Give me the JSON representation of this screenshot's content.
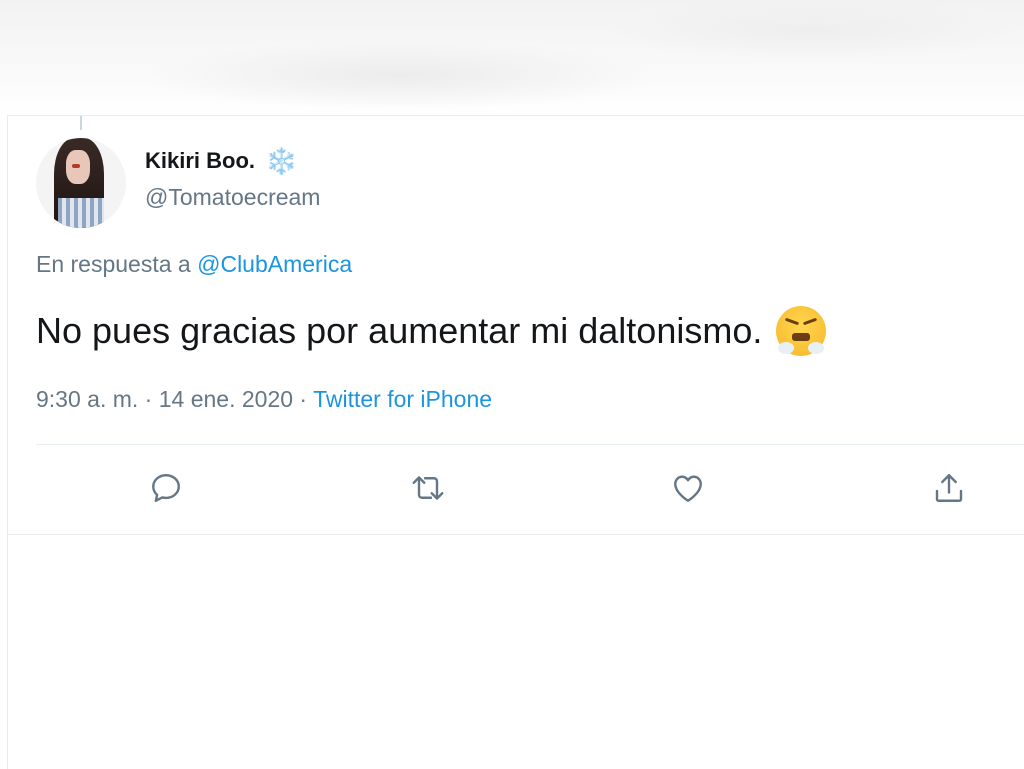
{
  "tweet": {
    "display_name": "Kikiri Boo.",
    "name_emoji": "❄️",
    "handle": "@Tomatoecream",
    "reply_prefix": "En respuesta a",
    "reply_to": "@ClubAmerica",
    "text": "No pues gracias por aumentar mi daltonismo.",
    "text_emoji": "face-with-steam-from-nose-emoji",
    "time": "9:30 a. m.",
    "dot1": "·",
    "date": "14 ene. 2020",
    "dot2": "·",
    "source": "Twitter for iPhone"
  },
  "actions": {
    "reply_icon": "reply-icon",
    "retweet_icon": "retweet-icon",
    "like_icon": "heart-icon",
    "share_icon": "share-icon"
  },
  "colors": {
    "link": "#1b95e0",
    "secondary_text": "#657786",
    "primary_text": "#14171a",
    "icon": "#657786"
  }
}
